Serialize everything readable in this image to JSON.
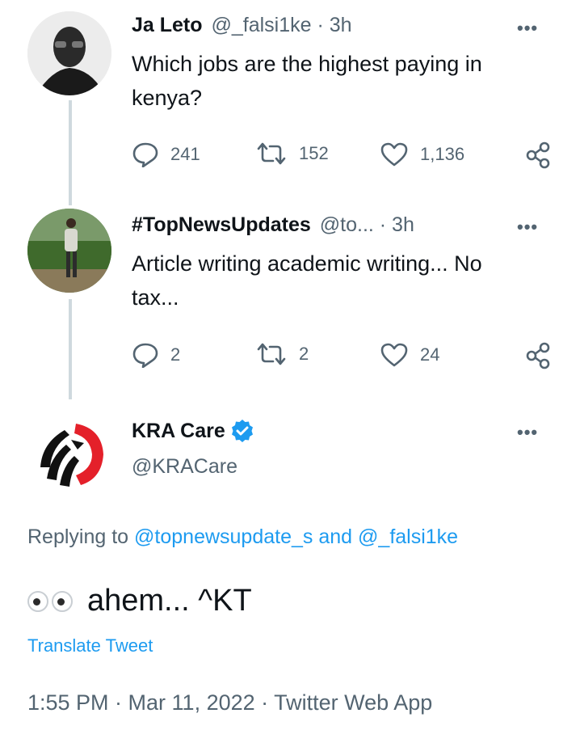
{
  "tweet1": {
    "name": "Ja Leto",
    "handle_time": "@_falsi1ke · 3h",
    "text_line1": "Which jobs are the highest paying in",
    "text_line2": "kenya?",
    "replies": "241",
    "retweets": "152",
    "likes": "1,136"
  },
  "tweet2": {
    "name": "#TopNewsUpdates",
    "handle_time": "@to... · 3h",
    "text_line1": "Article writing academic writing... No",
    "text_line2": "tax...",
    "replies": "2",
    "retweets": "2",
    "likes": "24"
  },
  "main": {
    "name": "KRA Care",
    "handle": "@KRACare",
    "replying_prefix": "Replying to",
    "reply_user1": "@topnewsupdate_s",
    "reply_and": "and",
    "reply_user2": "@_falsi1ke",
    "text": "ahem... ^KT",
    "translate": "Translate Tweet",
    "timestamp": "1:55 PM · Mar 11, 2022 · Twitter Web App",
    "more": "•••"
  },
  "icons": {
    "reply": "speech-bubble-icon",
    "retweet": "retweet-icon",
    "like": "heart-icon",
    "share": "share-icon",
    "verified": "verified-badge-icon",
    "eyes": "eyes-emoji"
  },
  "colors": {
    "accent": "#1d9bf0",
    "muted": "#536471",
    "thread_line": "#cfd9de",
    "kra_red": "#e4202a"
  }
}
